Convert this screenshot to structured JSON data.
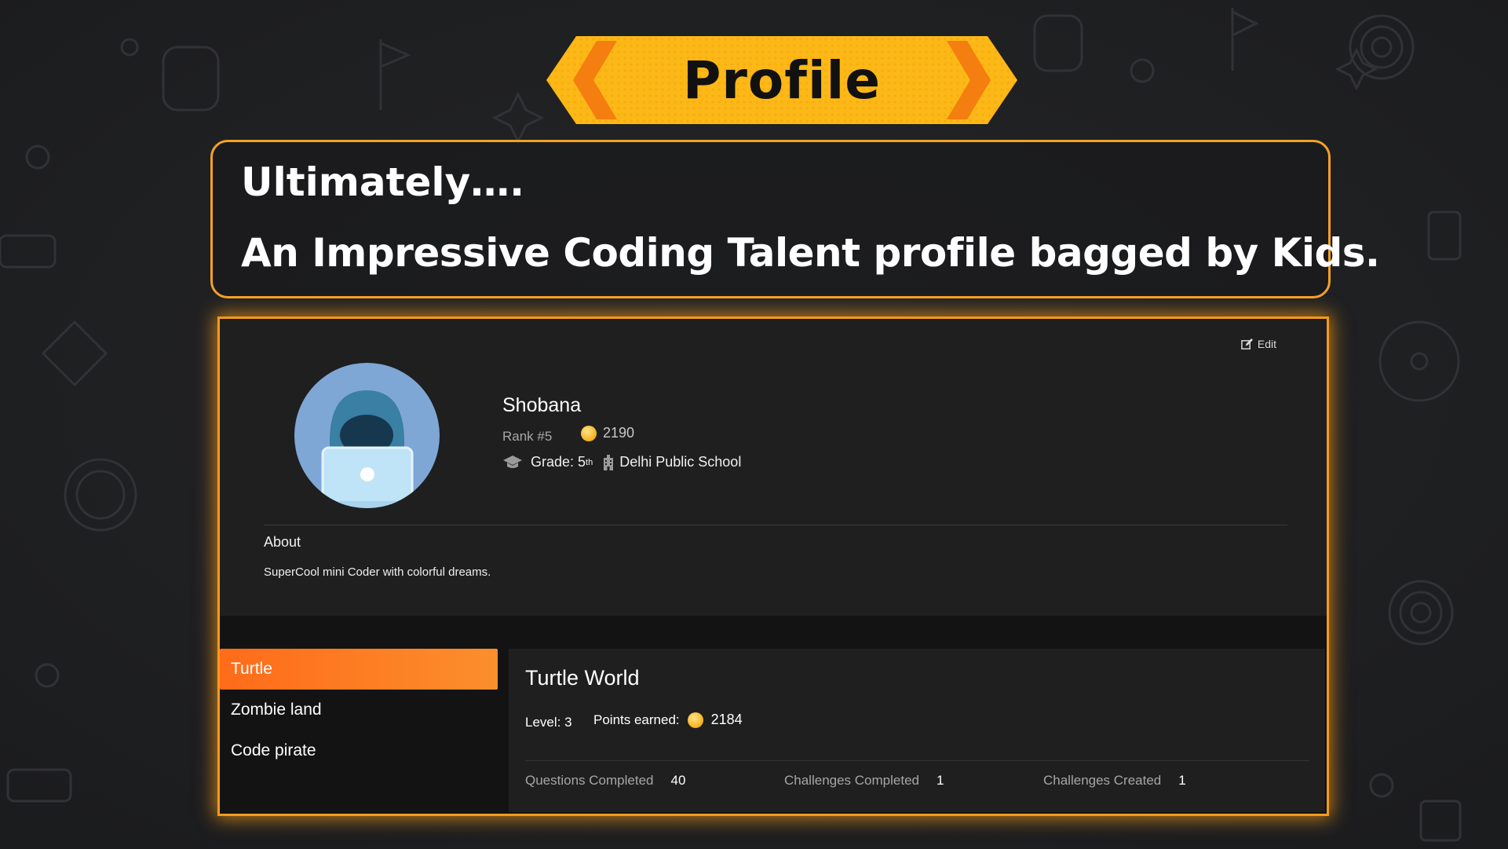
{
  "banner": {
    "title": "Profile"
  },
  "headline": {
    "line1": "Ultimately….",
    "line2": "An Impressive Coding Talent profile bagged by Kids."
  },
  "profile": {
    "edit_label": "Edit",
    "name": "Shobana",
    "rank": "Rank #5",
    "coins": "2190",
    "grade_label": "Grade: 5",
    "grade_suffix": "th",
    "school": "Delhi Public School",
    "about_label": "About",
    "about_text": "SuperCool mini Coder with colorful dreams."
  },
  "worlds": {
    "items": [
      {
        "label": "Turtle",
        "active": true
      },
      {
        "label": "Zombie land",
        "active": false
      },
      {
        "label": "Code pirate",
        "active": false
      }
    ]
  },
  "detail": {
    "title": "Turtle World",
    "level": "Level: 3",
    "points_label": "Points earned:",
    "points_value": "2184",
    "stats": [
      {
        "label": "Questions Completed",
        "value": "40"
      },
      {
        "label": "Challenges Completed",
        "value": "1"
      },
      {
        "label": "Challenges Created",
        "value": "1"
      }
    ]
  },
  "colors": {
    "accent_orange": "#f59a1a",
    "active_tab": "#ff6b1a",
    "banner_yellow": "#fdb51a"
  }
}
